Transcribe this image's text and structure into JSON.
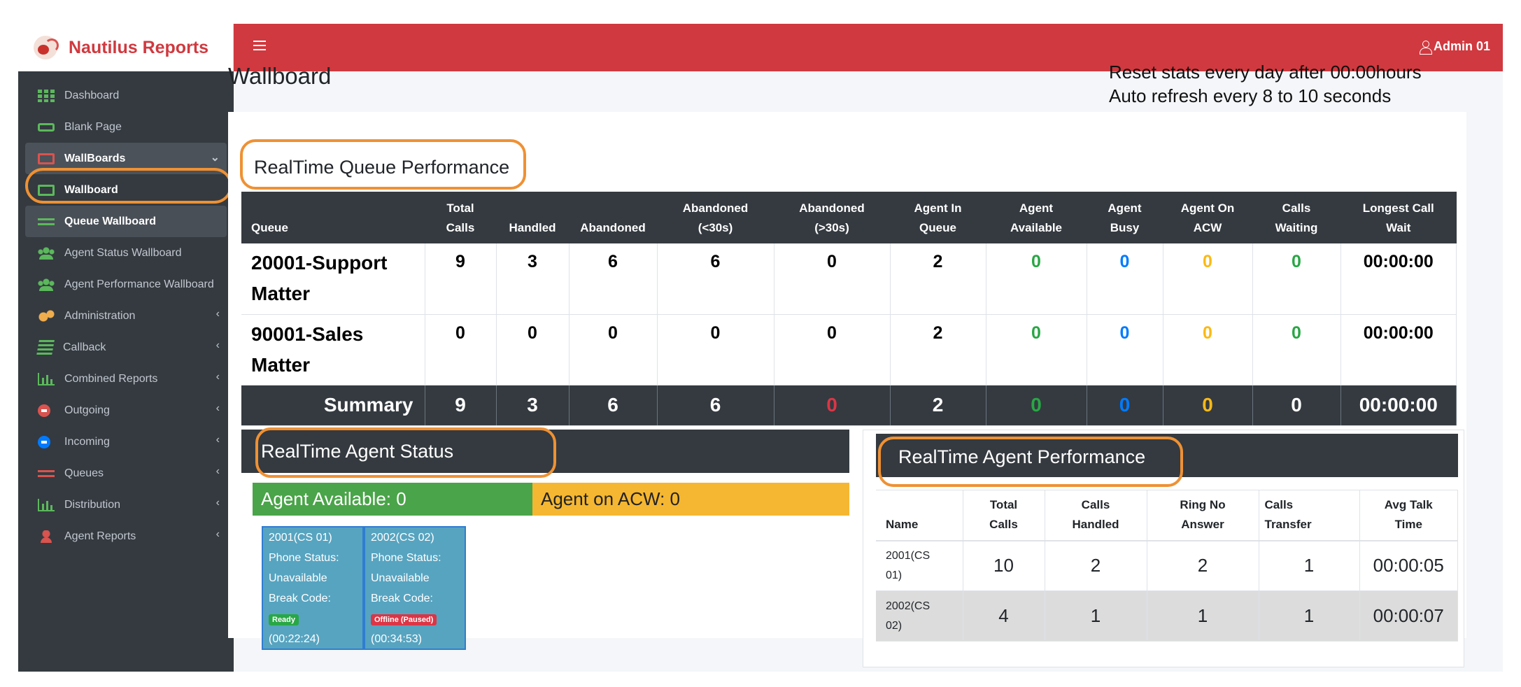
{
  "brand": {
    "name": "Nautilus Reports"
  },
  "topbar": {
    "user": "Admin 01"
  },
  "sidebar": {
    "items": [
      {
        "label": "Dashboard",
        "icon": "grid-icon"
      },
      {
        "label": "Blank Page",
        "icon": "rect-icon"
      },
      {
        "label": "WallBoards",
        "icon": "monitor-icon",
        "chevron": "⌄"
      },
      {
        "label": "Wallboard",
        "icon": "monitor-icon"
      },
      {
        "label": "Queue Wallboard",
        "icon": "lines-icon"
      },
      {
        "label": "Agent Status Wallboard",
        "icon": "users-icon"
      },
      {
        "label": "Agent Performance Wallboard",
        "icon": "users-icon"
      },
      {
        "label": "Administration",
        "icon": "cogs-icon",
        "chevron": "‹"
      },
      {
        "label": "Callback",
        "icon": "book-icon",
        "chevron": "‹"
      },
      {
        "label": "Combined Reports",
        "icon": "chart-icon",
        "chevron": "‹"
      },
      {
        "label": "Outgoing",
        "icon": "outgoing-icon",
        "chevron": "‹"
      },
      {
        "label": "Incoming",
        "icon": "incoming-icon",
        "chevron": "‹"
      },
      {
        "label": "Queues",
        "icon": "lines-icon",
        "chevron": "‹"
      },
      {
        "label": "Distribution",
        "icon": "chart-icon",
        "chevron": "‹"
      },
      {
        "label": "Agent Reports",
        "icon": "person-icon",
        "chevron": "‹"
      }
    ]
  },
  "page": {
    "title": "Wallboard",
    "note_line1": "Reset stats every day after 00:00hours",
    "note_line2": "Auto refresh every 8 to 10 seconds"
  },
  "queue": {
    "title": "RealTime Queue Performance",
    "headers": {
      "queue": "Queue",
      "total_1": "Total",
      "total_2": "Calls",
      "handled": "Handled",
      "abandoned": "Abandoned",
      "ab30_1": "Abandoned",
      "ab30_2": "(<30s)",
      "abg30_1": "Abandoned",
      "abg30_2": "(>30s)",
      "inq_1": "Agent In",
      "inq_2": "Queue",
      "avail_1": "Agent",
      "avail_2": "Available",
      "busy_1": "Agent",
      "busy_2": "Busy",
      "acw_1": "Agent On",
      "acw_2": "ACW",
      "waiting_1": "Calls",
      "waiting_2": "Waiting",
      "longest_1": "Longest Call",
      "longest_2": "Wait"
    },
    "rows": [
      {
        "name_1": "20001-Support",
        "name_2": "Matter",
        "total": "9",
        "handled": "3",
        "abandoned": "6",
        "ab30": "6",
        "abg30": "0",
        "inq": "2",
        "avail": "0",
        "busy": "0",
        "acw": "0",
        "waiting": "0",
        "longest": "00:00:00"
      },
      {
        "name_1": "90001-Sales",
        "name_2": "Matter",
        "total": "0",
        "handled": "0",
        "abandoned": "0",
        "ab30": "0",
        "abg30": "0",
        "inq": "2",
        "avail": "0",
        "busy": "0",
        "acw": "0",
        "waiting": "0",
        "longest": "00:00:00"
      }
    ],
    "summary": {
      "label": "Summary",
      "total": "9",
      "handled": "3",
      "abandoned": "6",
      "ab30": "6",
      "abg30": "0",
      "inq": "2",
      "avail": "0",
      "busy": "0",
      "acw": "0",
      "waiting": "0",
      "longest": "00:00:00"
    }
  },
  "agent_status": {
    "title": "RealTime Agent Status",
    "available": "Agent Available:  0",
    "acw": "Agent on ACW:  0",
    "agents": [
      {
        "id": "2001(CS 01)",
        "phone_label": "Phone Status:",
        "phone_status": "Unavailable",
        "break_label": "Break Code:",
        "badge": "Ready",
        "time": "(00:22:24)"
      },
      {
        "id": "2002(CS 02)",
        "phone_label": "Phone Status:",
        "phone_status": "Unavailable",
        "break_label": "Break Code:",
        "badge": "Offline (Paused)",
        "time": "(00:34:53)"
      }
    ]
  },
  "agent_perf": {
    "title": "RealTime Agent Performance",
    "headers": {
      "name": "Name",
      "total_1": "Total",
      "total_2": "Calls",
      "handled_1": "Calls",
      "handled_2": "Handled",
      "rna_1": "Ring No",
      "rna_2": "Answer",
      "transfer_1": "Calls",
      "transfer_2": "Transfer",
      "talk_1": "Avg Talk",
      "talk_2": "Time"
    },
    "rows": [
      {
        "name_1": "2001(CS",
        "name_2": "01)",
        "total": "10",
        "handled": "2",
        "rna": "2",
        "transfer": "1",
        "talk": "00:00:05"
      },
      {
        "name_1": "2002(CS",
        "name_2": "02)",
        "total": "4",
        "handled": "1",
        "rna": "1",
        "transfer": "1",
        "talk": "00:00:07"
      }
    ]
  },
  "colors": {
    "brand_red": "#d0393f",
    "sidebar": "#343a40",
    "highlight": "#ef9134",
    "green": "#28a745",
    "blue": "#007bff",
    "orange": "#fbb915"
  }
}
